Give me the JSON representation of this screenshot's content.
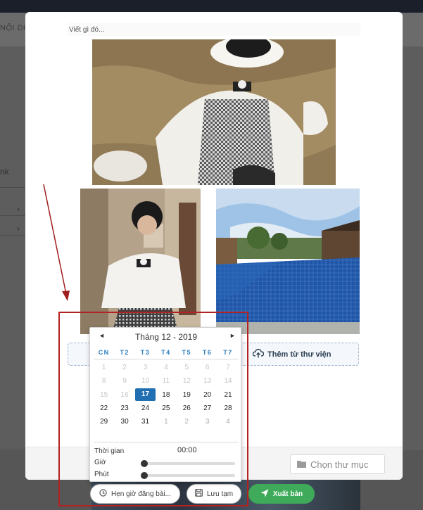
{
  "background": {
    "tab_label": "NỘI DU",
    "side_label": "nk"
  },
  "composer": {
    "placeholder": "Viết gì đó..."
  },
  "upload": {
    "library_label": "Thêm từ thư viện",
    "library_icon": "cloud-upload-icon"
  },
  "footer": {
    "folder_placeholder": "Chọn thư mục",
    "folder_icon": "folder-icon"
  },
  "datepicker": {
    "prev": "◄",
    "next": "►",
    "title": "Tháng 12 - 2019",
    "weekdays": [
      "CN",
      "T2",
      "T3",
      "T4",
      "T5",
      "T6",
      "T7"
    ],
    "weeks": [
      [
        "1",
        "2",
        "3",
        "4",
        "5",
        "6",
        "7"
      ],
      [
        "8",
        "9",
        "10",
        "11",
        "12",
        "13",
        "14"
      ],
      [
        "15",
        "16",
        "17",
        "18",
        "19",
        "20",
        "21"
      ],
      [
        "22",
        "23",
        "24",
        "25",
        "26",
        "27",
        "28"
      ],
      [
        "29",
        "30",
        "31",
        "1",
        "2",
        "3",
        "4"
      ]
    ],
    "selected_day": "17",
    "time_label": "Thời gian",
    "time_value": "00:00",
    "hour_label": "Giờ",
    "minute_label": "Phút",
    "hour_value": 0,
    "minute_value": 0,
    "accent_color": "#1f6fb2"
  },
  "actions": {
    "schedule_label": "Hẹn giờ đăng bài...",
    "draft_label": "Lưu tạm",
    "publish_label": "Xuất bản",
    "publish_color": "#3fab5a"
  }
}
